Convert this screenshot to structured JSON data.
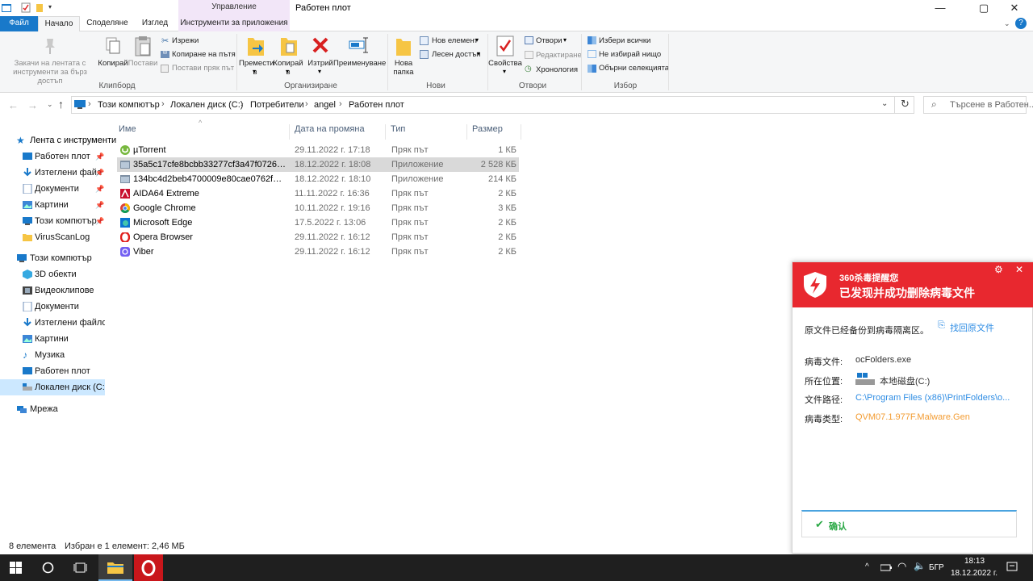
{
  "window": {
    "title": "Работен плот",
    "context_tab_header": "Управление"
  },
  "tabs": {
    "file": "Файл",
    "home": "Начало",
    "share": "Споделяне",
    "view": "Изглед",
    "app_tools": "Инструменти за приложения"
  },
  "ribbon": {
    "clipboard": {
      "label": "Клипборд",
      "pin": "Закачи на лентата с инструменти за бърз достъп",
      "copy": "Копирай",
      "paste": "Постави",
      "cut": "Изрежи",
      "copy_path": "Копиране на пътя",
      "paste_shortcut": "Постави пряк път"
    },
    "organize": {
      "label": "Организиране",
      "move_to": "Премести в",
      "copy_to": "Копирай в",
      "delete": "Изтрий",
      "rename": "Преименуване"
    },
    "new": {
      "label": "Нови",
      "new_folder": "Нова папка",
      "new_item": "Нов елемент",
      "easy_access": "Лесен достъп"
    },
    "open": {
      "label": "Отвори",
      "properties": "Свойства",
      "open": "Отвори",
      "edit": "Редактиране",
      "history": "Хронология"
    },
    "select": {
      "label": "Избор",
      "select_all": "Избери всички",
      "select_none": "Не избирай нищо",
      "invert": "Обърни селекцията"
    }
  },
  "address": {
    "crumbs": [
      "Този компютър",
      "Локален диск (C:)",
      "Потребители",
      "angel",
      "Работен плот"
    ],
    "search_placeholder": "Търсене в Работен..."
  },
  "nav": {
    "quick_access": "Лента с инструменти",
    "quick_items": [
      "Работен плот",
      "Изтеглени файл",
      "Документи",
      "Картини",
      "Този компютър",
      "VirusScanLog"
    ],
    "this_pc": "Този компютър",
    "pc_items": [
      "3D обекти",
      "Видеоклипове",
      "Документи",
      "Изтеглени файлове",
      "Картини",
      "Музика",
      "Работен плот",
      "Локален диск (C:)"
    ],
    "network": "Мрежа"
  },
  "columns": {
    "name": "Име",
    "date": "Дата на промяна",
    "type": "Тип",
    "size": "Размер"
  },
  "files": [
    {
      "name": "µTorrent",
      "date": "29.11.2022 г. 17:18",
      "type": "Пряк път",
      "size": "1 КБ"
    },
    {
      "name": "35a5c17cfe8bcbb33277cf3a47f0726ae0e...",
      "date": "18.12.2022 г. 18:08",
      "type": "Приложение",
      "size": "2 528 КБ"
    },
    {
      "name": "134bc4d2beb4700009e80cae0762f731a3...",
      "date": "18.12.2022 г. 18:10",
      "type": "Приложение",
      "size": "214 КБ"
    },
    {
      "name": "AIDA64 Extreme",
      "date": "11.11.2022 г. 16:36",
      "type": "Пряк път",
      "size": "2 КБ"
    },
    {
      "name": "Google Chrome",
      "date": "10.11.2022 г. 19:16",
      "type": "Пряк път",
      "size": "3 КБ"
    },
    {
      "name": "Microsoft Edge",
      "date": "17.5.2022 г. 13:06",
      "type": "Пряк път",
      "size": "2 КБ"
    },
    {
      "name": "Opera Browser",
      "date": "29.11.2022 г. 16:12",
      "type": "Пряк път",
      "size": "2 КБ"
    },
    {
      "name": "Viber",
      "date": "29.11.2022 г. 16:12",
      "type": "Пряк път",
      "size": "2 КБ"
    }
  ],
  "status": {
    "count": "8 елемента",
    "selection": "Избран е 1 елемент: 2,46 МБ"
  },
  "popup": {
    "brand": "360杀毒提醒您",
    "headline": "已发现并成功删除病毒文件",
    "backup_note": "原文件已经备份到病毒隔离区。",
    "restore_link": "找回原文件",
    "virus_file_label": "病毒文件:",
    "virus_file": "ocFolders.exe",
    "location_label": "所在位置:",
    "location": "本地磁盘(C:)",
    "path_label": "文件路径:",
    "path": "C:\\Program Files (x86)\\PrintFolders\\o...",
    "type_label": "病毒类型:",
    "type": "QVM07.1.977F.Malware.Gen",
    "confirm": "确认"
  },
  "taskbar": {
    "lang": "БГР",
    "time": "18:13",
    "date": "18.12.2022 г."
  },
  "colors": {
    "accent": "#1979ca",
    "popup_red": "#e8282f",
    "link_blue": "#2f8de4",
    "virus_orange": "#f39c32",
    "confirm_green": "#2aa845"
  }
}
